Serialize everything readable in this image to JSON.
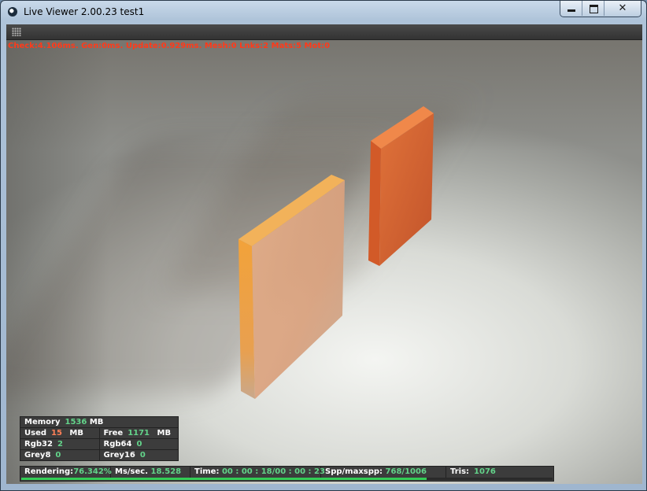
{
  "window": {
    "title": "Live Viewer 2.00.23 test1"
  },
  "window_controls": {
    "minimize": "",
    "maximize": "",
    "close": "✕"
  },
  "stats_line": "Check:4.106ms. Gen:0ms. Update:0.929ms. Mesh:0 Lnks:2 Mats:5 Mot:0",
  "memory": {
    "memory_label": "Memory",
    "memory_value": "1536",
    "memory_unit": "MB",
    "used_label": "Used",
    "used_value": "15",
    "used_unit": "MB",
    "free_label": "Free",
    "free_value": "1171",
    "free_unit": "MB",
    "rgb32_label": "Rgb32",
    "rgb32_value": "2",
    "rgb64_label": "Rgb64",
    "rgb64_value": "0",
    "grey8_label": "Grey8",
    "grey8_value": "0",
    "grey16_label": "Grey16",
    "grey16_value": "0"
  },
  "render_status": {
    "rendering_label": "Rendering:",
    "rendering_value": "76.342%",
    "ms_label": "Ms/sec.",
    "ms_value": "18.528",
    "time_label": "Time:",
    "time_value": "00 : 00 : 18/00 : 00 : 23",
    "spp_label": "Spp/maxspp:",
    "spp_value": "768/1006",
    "tris_label": "Tris:",
    "tris_value": "1076",
    "progress_fraction": 0.76342
  },
  "colors": {
    "stats_text": "#ff3a1a",
    "value_green": "#63d38a",
    "value_red": "#ff7f57",
    "progress": "#33cc55",
    "panel_bg": "#3c3c3c"
  }
}
